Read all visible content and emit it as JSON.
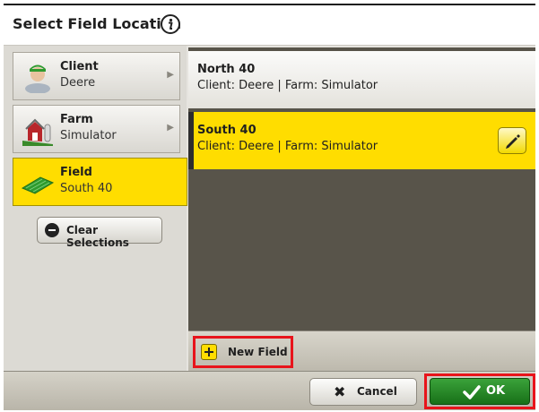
{
  "header": {
    "title": "Select Field Location",
    "info_icon": "info-icon"
  },
  "nav": {
    "items": [
      {
        "title": "Client",
        "value": "Deere",
        "icon": "client-person-icon",
        "active": false
      },
      {
        "title": "Farm",
        "value": "Simulator",
        "icon": "farm-barn-icon",
        "active": false
      },
      {
        "title": "Field",
        "value": "South 40",
        "icon": "field-icon",
        "active": true
      }
    ],
    "clear_label": "Clear Selections"
  },
  "fields": {
    "items": [
      {
        "name": "North 40",
        "detail": "Client: Deere | Farm: Simulator",
        "selected": false
      },
      {
        "name": "South 40",
        "detail": "Client: Deere | Farm: Simulator",
        "selected": true
      }
    ],
    "new_field_label": "New Field"
  },
  "footer": {
    "cancel_label": "Cancel",
    "ok_label": "OK"
  },
  "colors": {
    "accent_yellow": "#ffdd00",
    "ok_green": "#2a8a2a",
    "highlight_red": "#e8141b",
    "list_background": "#58544a"
  }
}
